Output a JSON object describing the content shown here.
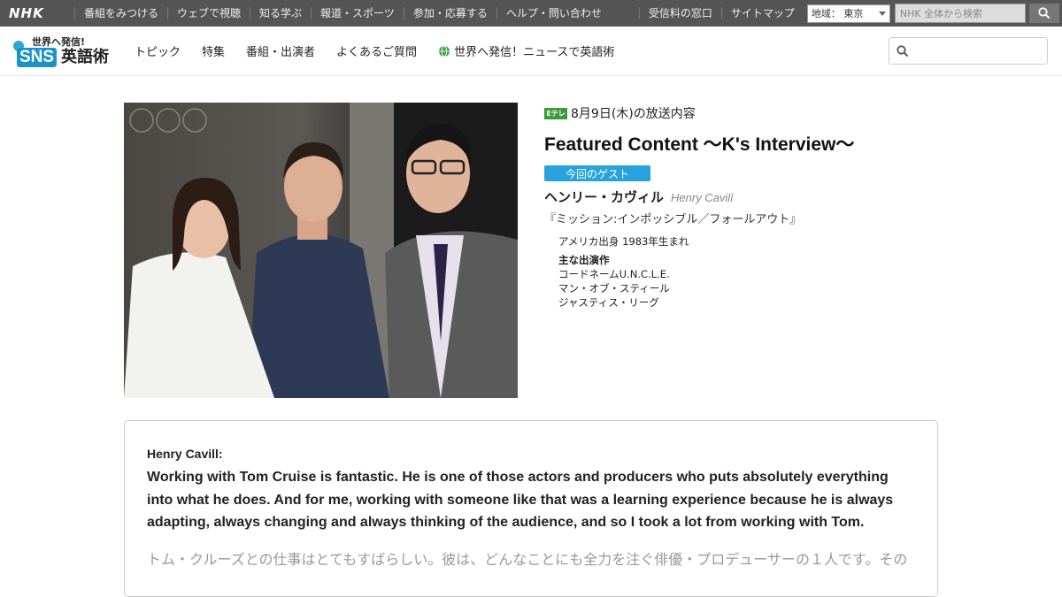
{
  "globalbar": {
    "logo": "NHK",
    "links": [
      "番組をみつける",
      "ウェブで視聴",
      "知る学ぶ",
      "報道・スポーツ",
      "参加・応募する",
      "ヘルプ・問い合わせ"
    ],
    "links2": [
      "受信料の窓口",
      "サイトマップ"
    ],
    "region": "地域： 東京",
    "search_placeholder": "NHK 全体から検索"
  },
  "header": {
    "logo_top": "世界へ発信!",
    "logo_sns": "SNS",
    "logo_eigo": "英語術",
    "nav": [
      "トピック",
      "特集",
      "番組・出演者",
      "よくあるご質問",
      "世界へ発信！ニュースで英語術"
    ]
  },
  "episode": {
    "channel": "Eテレ",
    "date": "8月9日(木)の放送内容",
    "title": "Featured Content 〜K's Interview〜",
    "guest_badge": "今回のゲスト",
    "guest_name": "ヘンリー・カヴィル",
    "guest_name_en": "Henry Cavill",
    "movie": "『ミッション:インポッシブル／フォールアウト』",
    "born": "アメリカ出身 1983年生まれ",
    "works_heading": "主な出演作",
    "works": [
      "コードネームU.N.C.L.E.",
      "マン・オブ・スティール",
      "ジャスティス・リーグ"
    ]
  },
  "interview": {
    "speaker": "Henry Cavill:",
    "quote": "Working with Tom Cruise is fantastic. He is one of those actors and producers who puts absolutely everything into what he does. And for me, working with someone like that was a learning experience because he is always adapting, always changing and always thinking of the audience, and so I took a lot from working with Tom.",
    "translation": "トム・クルーズとの仕事はとてもすばらしい。彼は、どんなことにも全力を注ぐ俳優・プロデューサーの１人です。その"
  },
  "colors": {
    "globalbar_bg": "#555555",
    "brand_blue": "#1b93c9",
    "badge_blue": "#29a3dd",
    "etele_green": "#3a9a3a"
  }
}
